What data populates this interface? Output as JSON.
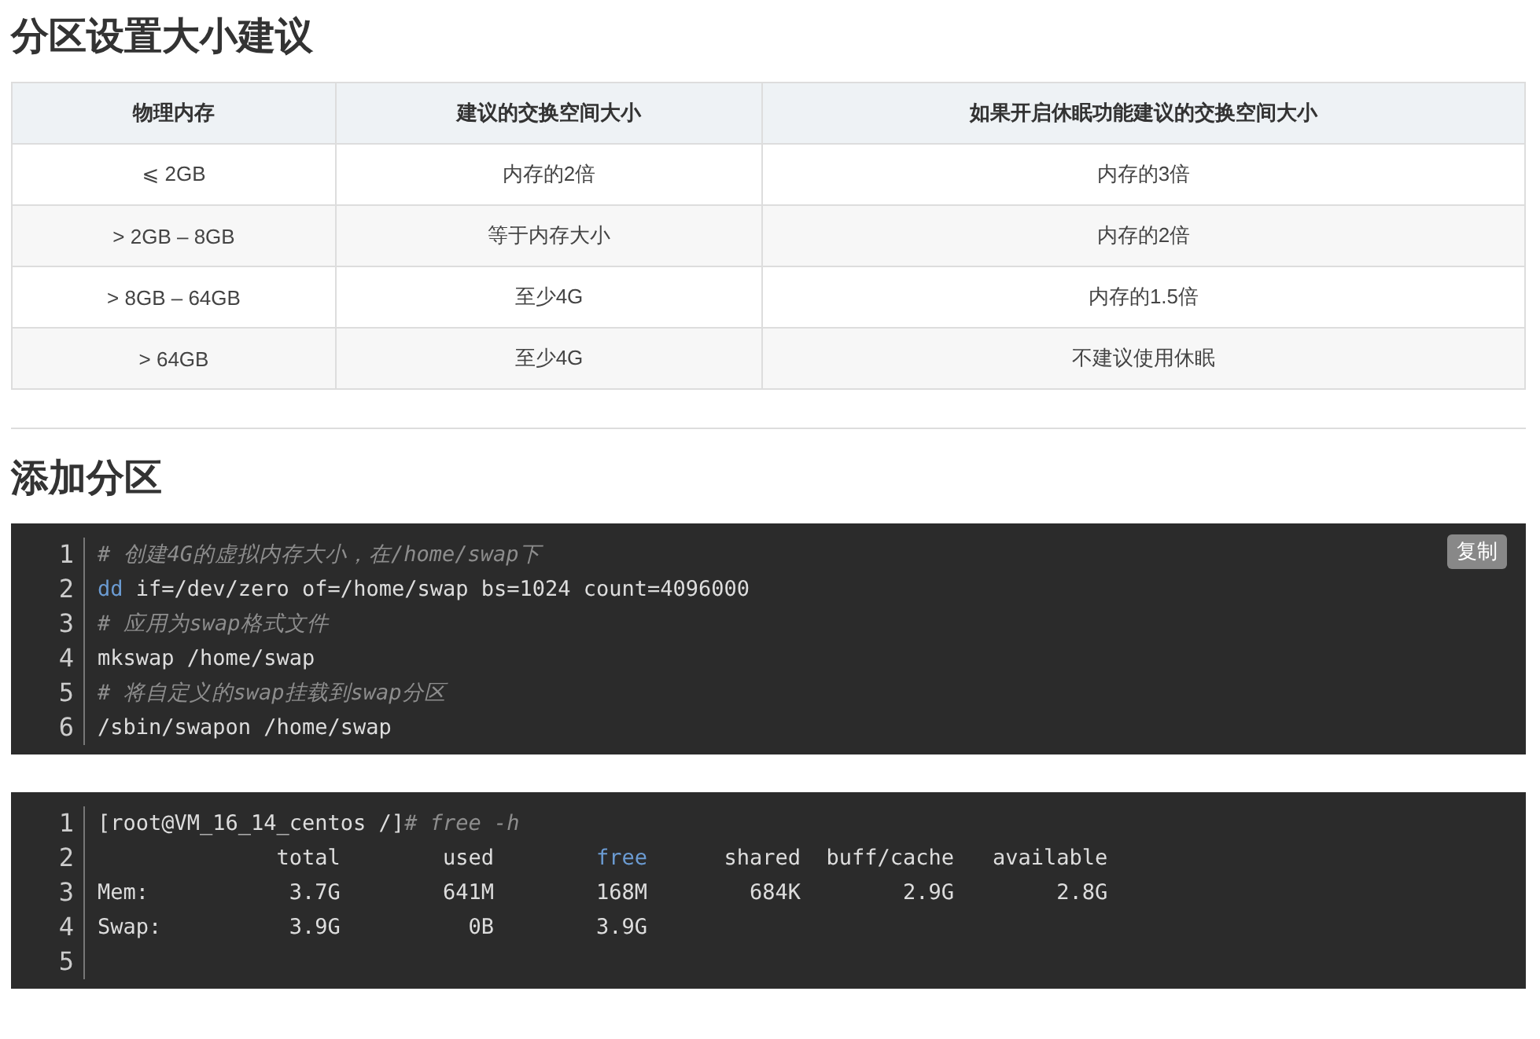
{
  "sections": [
    {
      "kind": "table",
      "title": "分区设置大小建议",
      "table": {
        "columns": [
          "物理内存",
          "建议的交换空间大小",
          "如果开启休眠功能建议的交换空间大小"
        ],
        "rows": [
          [
            "⩽ 2GB",
            "内存的2倍",
            "内存的3倍"
          ],
          [
            "> 2GB – 8GB",
            "等于内存大小",
            "内存的2倍"
          ],
          [
            "> 8GB – 64GB",
            "至少4G",
            "内存的1.5倍"
          ],
          [
            "> 64GB",
            "至少4G",
            "不建议使用休眠"
          ]
        ]
      }
    },
    {
      "kind": "code",
      "title": "添加分区",
      "blocks": [
        {
          "copy_button": "复制",
          "lines": [
            {
              "number": "1",
              "tokens": [
                {
                  "kind": "comment",
                  "text": "# 创建4G的虚拟内存大小，在/home/swap下"
                }
              ]
            },
            {
              "number": "2",
              "tokens": [
                {
                  "kind": "keyword",
                  "text": "dd"
                },
                {
                  "kind": "plain",
                  "text": " if=/dev/zero of=/home/swap bs=1024 count=4096000"
                }
              ]
            },
            {
              "number": "3",
              "tokens": [
                {
                  "kind": "comment",
                  "text": "# 应用为swap格式文件"
                }
              ]
            },
            {
              "number": "4",
              "tokens": [
                {
                  "kind": "plain",
                  "text": "mkswap /home/swap"
                }
              ]
            },
            {
              "number": "5",
              "tokens": [
                {
                  "kind": "comment",
                  "text": "# 将自定义的swap挂载到swap分区"
                }
              ]
            },
            {
              "number": "6",
              "tokens": [
                {
                  "kind": "plain",
                  "text": "/sbin/swapon /home/swap"
                }
              ]
            }
          ]
        },
        {
          "lines": [
            {
              "number": "1",
              "tokens": [
                {
                  "kind": "plain",
                  "text": "[root@VM_16_14_centos /]"
                },
                {
                  "kind": "comment",
                  "text": "# free -h"
                }
              ]
            },
            {
              "number": "2",
              "tokens": [
                {
                  "kind": "plain",
                  "text": "              total        used        "
                },
                {
                  "kind": "keyword",
                  "text": "free"
                },
                {
                  "kind": "plain",
                  "text": "      shared  buff/cache   available"
                }
              ]
            },
            {
              "number": "3",
              "tokens": [
                {
                  "kind": "plain",
                  "text": "Mem:           3.7G        641M        168M        684K        2.9G        2.8G"
                }
              ]
            },
            {
              "number": "4",
              "tokens": [
                {
                  "kind": "plain",
                  "text": "Swap:          3.9G          0B        3.9G"
                }
              ]
            },
            {
              "number": "5"
            }
          ]
        }
      ]
    }
  ]
}
